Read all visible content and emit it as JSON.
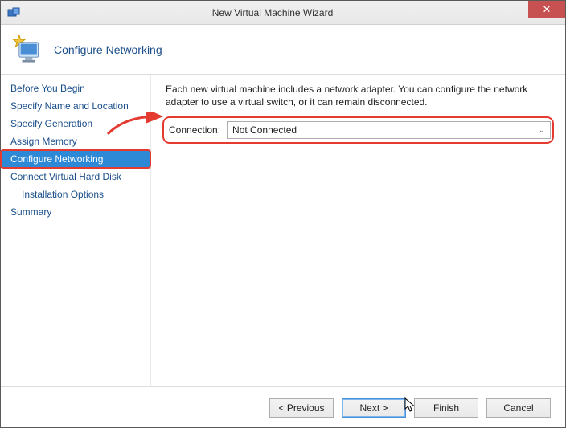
{
  "window": {
    "title": "New Virtual Machine Wizard"
  },
  "header": {
    "title": "Configure Networking"
  },
  "sidebar": {
    "items": [
      {
        "label": "Before You Begin"
      },
      {
        "label": "Specify Name and Location"
      },
      {
        "label": "Specify Generation"
      },
      {
        "label": "Assign Memory"
      },
      {
        "label": "Configure Networking"
      },
      {
        "label": "Connect Virtual Hard Disk"
      },
      {
        "label": "Installation Options"
      },
      {
        "label": "Summary"
      }
    ],
    "selected_index": 4
  },
  "content": {
    "description": "Each new virtual machine includes a network adapter. You can configure the network adapter to use a virtual switch, or it can remain disconnected.",
    "connection_label": "Connection:",
    "connection_value": "Not Connected"
  },
  "buttons": {
    "previous": "< Previous",
    "next": "Next >",
    "finish": "Finish",
    "cancel": "Cancel"
  },
  "annotation": {
    "highlight_color": "#e43a2f"
  }
}
